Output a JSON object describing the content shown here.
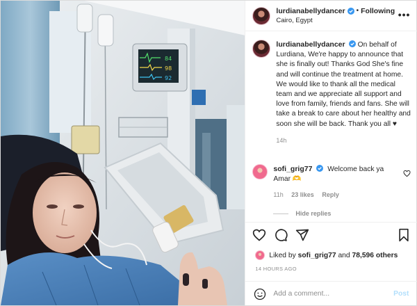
{
  "post": {
    "username": "lurdianabellydancer",
    "follow_label": "Following",
    "location": "Cairo, Egypt",
    "more_label": "•••",
    "dot": "•"
  },
  "caption": {
    "username": "lurdianabellydancer",
    "text": "On behalf of Lurdiana, We're happy to announce that she is finally out! Thanks God She's fine and will continue the treatment at home. We would like to thank all the medical team and we appreciate all support and love from family, friends and fans. She will take a break to care about her healthy and soon she will be back. Thank you all ♥",
    "time": "14h"
  },
  "comments": [
    {
      "username": "sofi_grig77",
      "text": "Welcome back ya Amar 🫶",
      "time": "11h",
      "likes": "23 likes",
      "reply": "Reply",
      "hide_replies": "Hide replies"
    }
  ],
  "likes": {
    "prefix": "Liked by",
    "user": "sofi_grig77",
    "and": "and",
    "others": "78,596 others"
  },
  "timestamp": "14 HOURS AGO",
  "composer": {
    "placeholder": "Add a comment...",
    "post_label": "Post"
  },
  "monitor": {
    "readings": [
      "84",
      "98",
      "92"
    ]
  },
  "colors": {
    "verified": "#3897f0",
    "link": "#b2dffc",
    "muted": "#8e8e8e",
    "gown": "#4a7fb8"
  },
  "icons": [
    "heart-icon",
    "comment-icon",
    "share-icon",
    "bookmark-icon",
    "smiley-icon",
    "verified-icon",
    "more-icon"
  ]
}
